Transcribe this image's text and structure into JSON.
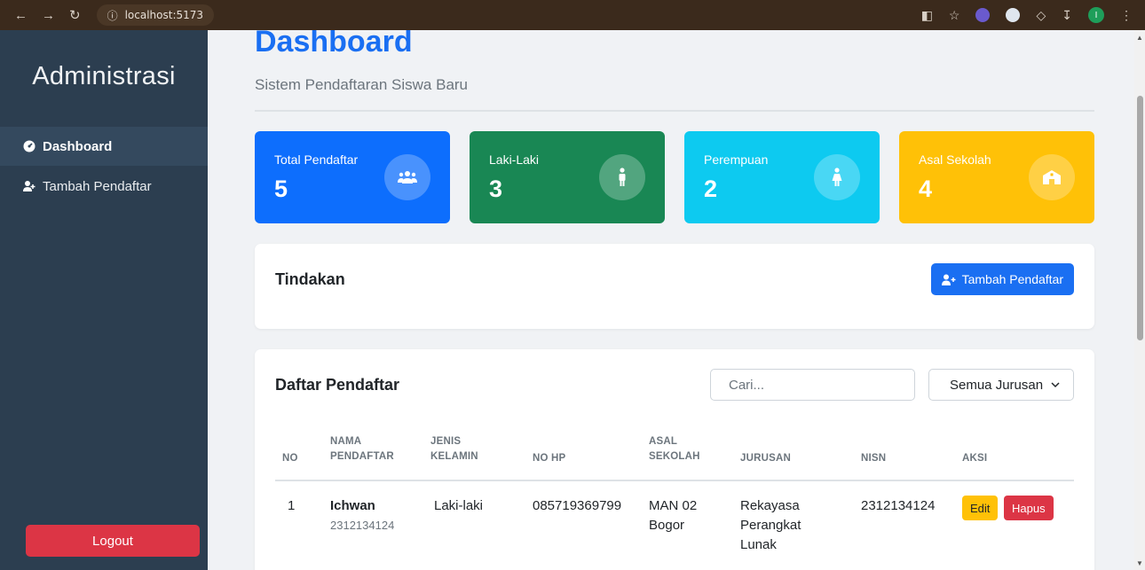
{
  "browser": {
    "url": "localhost:5173",
    "profile_initial": "I"
  },
  "sidebar": {
    "brand": "Administrasi",
    "items": [
      {
        "label": "Dashboard",
        "icon": "dashboard-icon"
      },
      {
        "label": "Tambah Pendaftar",
        "icon": "user-plus-icon"
      }
    ],
    "logout_label": "Logout"
  },
  "header": {
    "title": "Dashboard",
    "subtitle": "Sistem Pendaftaran Siswa Baru"
  },
  "stats": [
    {
      "label": "Total Pendaftar",
      "value": "5",
      "color": "#0d6efd",
      "icon": "users-icon"
    },
    {
      "label": "Laki-Laki",
      "value": "3",
      "color": "#198754",
      "icon": "male-icon"
    },
    {
      "label": "Perempuan",
      "value": "2",
      "color": "#0dcaf0",
      "icon": "female-icon"
    },
    {
      "label": "Asal Sekolah",
      "value": "4",
      "color": "#ffc107",
      "icon": "school-icon"
    }
  ],
  "actions": {
    "title": "Tindakan",
    "add_button": "Tambah Pendaftar"
  },
  "list": {
    "title": "Daftar Pendaftar",
    "search_placeholder": "Cari...",
    "filter_selected": "Semua Jurusan",
    "columns": {
      "no": "NO",
      "nama_1": "NAMA",
      "nama_2": "PENDAFTAR",
      "jk_1": "JENIS",
      "jk_2": "KELAMIN",
      "hp": "NO HP",
      "sekolah_1": "ASAL",
      "sekolah_2": "SEKOLAH",
      "jurusan": "JURUSAN",
      "nisn": "NISN",
      "aksi": "AKSI"
    },
    "rows": [
      {
        "no": "1",
        "nama": "Ichwan",
        "nama_sub": "2312134124",
        "jenis_kelamin": "Laki-laki",
        "no_hp": "085719369799",
        "asal_1": "MAN 02",
        "asal_2": "Bogor",
        "jurusan_1": "Rekayasa",
        "jurusan_2": "Perangkat",
        "jurusan_3": "Lunak",
        "nisn": "2312134124",
        "edit_label": "Edit",
        "delete_label": "Hapus"
      }
    ]
  }
}
